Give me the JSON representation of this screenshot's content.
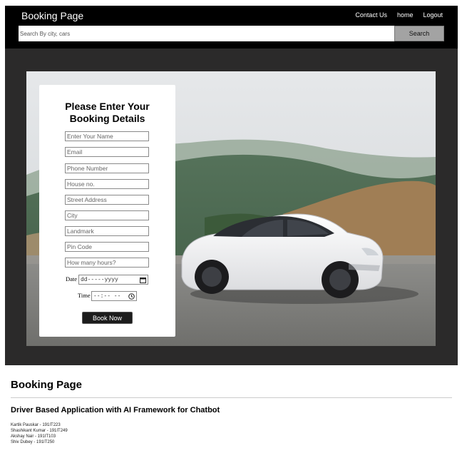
{
  "navbar": {
    "brand": "Booking Page",
    "links": [
      "Contact Us",
      "home",
      "Logout"
    ],
    "search_placeholder": "Search By city, cars",
    "search_button": "Search"
  },
  "form": {
    "title_line1": "Please Enter Your",
    "title_line2": "Booking Details",
    "fields": [
      "Enter Your Name",
      "Email",
      "Phone Number",
      "House no.",
      "Street Address",
      "City",
      "Landmark",
      "Pin Code",
      "How many hours?"
    ],
    "date_label": "Date",
    "date_placeholder": "dd-----yyyy",
    "time_label": "Time",
    "time_placeholder": "--:-- --",
    "submit": "Book Now"
  },
  "footer": {
    "title": "Booking Page",
    "subtitle": "Driver Based Application with AI Framework for Chatbot",
    "members": [
      "Kartik Pauskar - 191IT223",
      "Shashikant Kumar - 191IT249",
      "Akshay Nair - 191IT103",
      "Shiv Dubey - 191IT250"
    ]
  },
  "colors": {
    "navbar_bg": "#000000",
    "hero_bg": "#2b2a2a",
    "search_button_bg": "#a3a3a3",
    "book_button_bg": "#1c1c1c"
  }
}
